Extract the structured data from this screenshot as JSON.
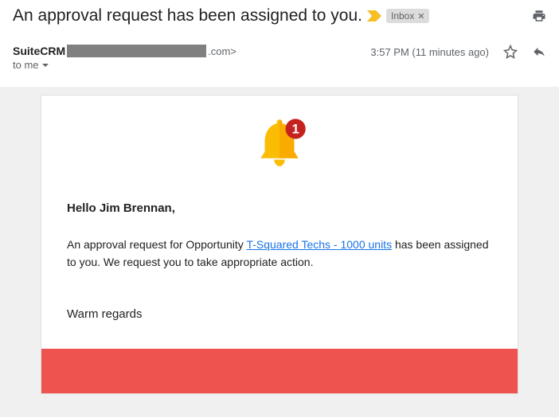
{
  "header": {
    "subject": "An approval request has been assigned to you.",
    "label": "Inbox"
  },
  "sender": {
    "name": "SuiteCRM",
    "domain_suffix": ".com>",
    "to_line": "to me"
  },
  "meta": {
    "timestamp": "3:57 PM (11 minutes ago)"
  },
  "body": {
    "greeting": "Hello Jim Brennan,",
    "pre_text": "An approval request for Opportunity ",
    "link_text": "T-Squared Techs - 1000 units",
    "post_text": " has been assigned to you. We request you to take appropriate action.",
    "regards": "Warm regards"
  },
  "notif_badge": "1"
}
